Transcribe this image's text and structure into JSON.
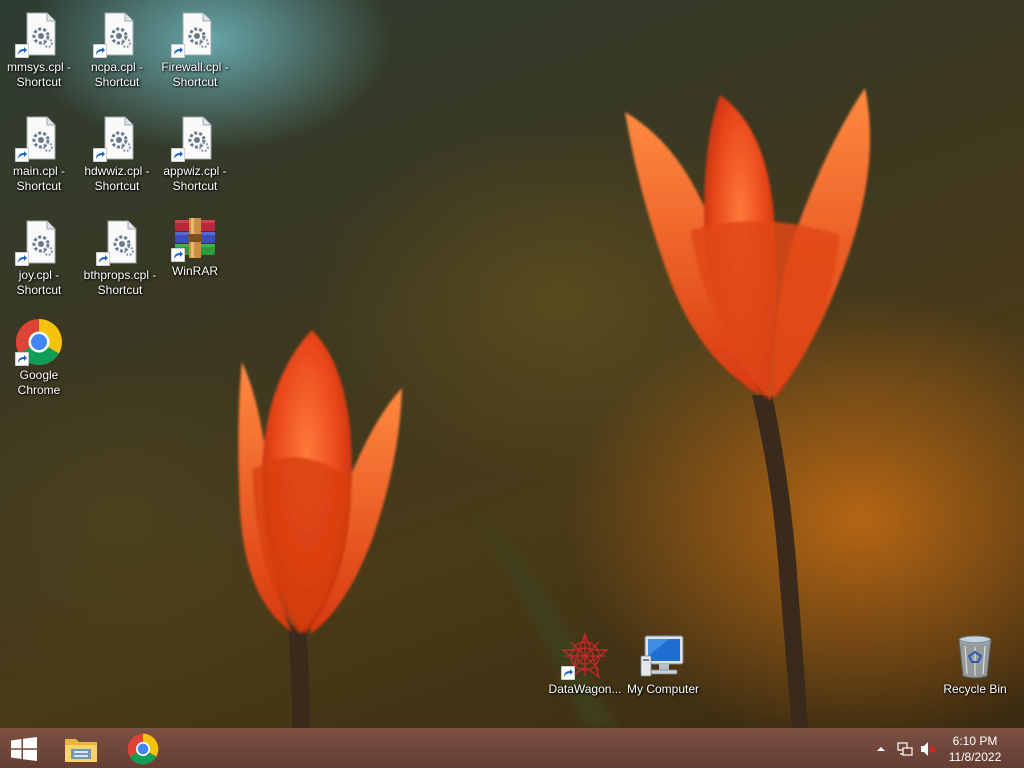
{
  "desktop": {
    "icons": [
      {
        "label": "mmsys.cpl - Shortcut",
        "icon": "control-panel-file-icon"
      },
      {
        "label": "ncpa.cpl - Shortcut",
        "icon": "control-panel-file-icon"
      },
      {
        "label": "Firewall.cpl - Shortcut",
        "icon": "control-panel-file-icon"
      },
      {
        "label": "main.cpl - Shortcut",
        "icon": "control-panel-file-icon"
      },
      {
        "label": "hdwwiz.cpl - Shortcut",
        "icon": "control-panel-file-icon"
      },
      {
        "label": "appwiz.cpl - Shortcut",
        "icon": "control-panel-file-icon"
      },
      {
        "label": "joy.cpl - Shortcut",
        "icon": "control-panel-file-icon"
      },
      {
        "label": "bthprops.cpl - Shortcut",
        "icon": "control-panel-file-icon"
      },
      {
        "label": "WinRAR",
        "icon": "winrar-icon"
      },
      {
        "label": "Google Chrome",
        "icon": "chrome-icon"
      },
      {
        "label": "DataWagon...",
        "icon": "datawagon-icon"
      },
      {
        "label": "My Computer",
        "icon": "computer-icon"
      },
      {
        "label": "Recycle Bin",
        "icon": "recycle-bin-icon"
      }
    ]
  },
  "taskbar": {
    "start": "start-button",
    "pinned": [
      {
        "name": "File Explorer",
        "icon": "folder-icon"
      },
      {
        "name": "Google Chrome",
        "icon": "chrome-icon"
      }
    ],
    "tray": {
      "overflow_icon": "chevron-up-icon",
      "network_icon": "network-icon",
      "volume_icon": "volume-muted-icon"
    },
    "clock": {
      "time": "6:10 PM",
      "date": "11/8/2022"
    }
  },
  "colors": {
    "taskbar": "#6a3f31",
    "tulip": "#e8461a"
  }
}
